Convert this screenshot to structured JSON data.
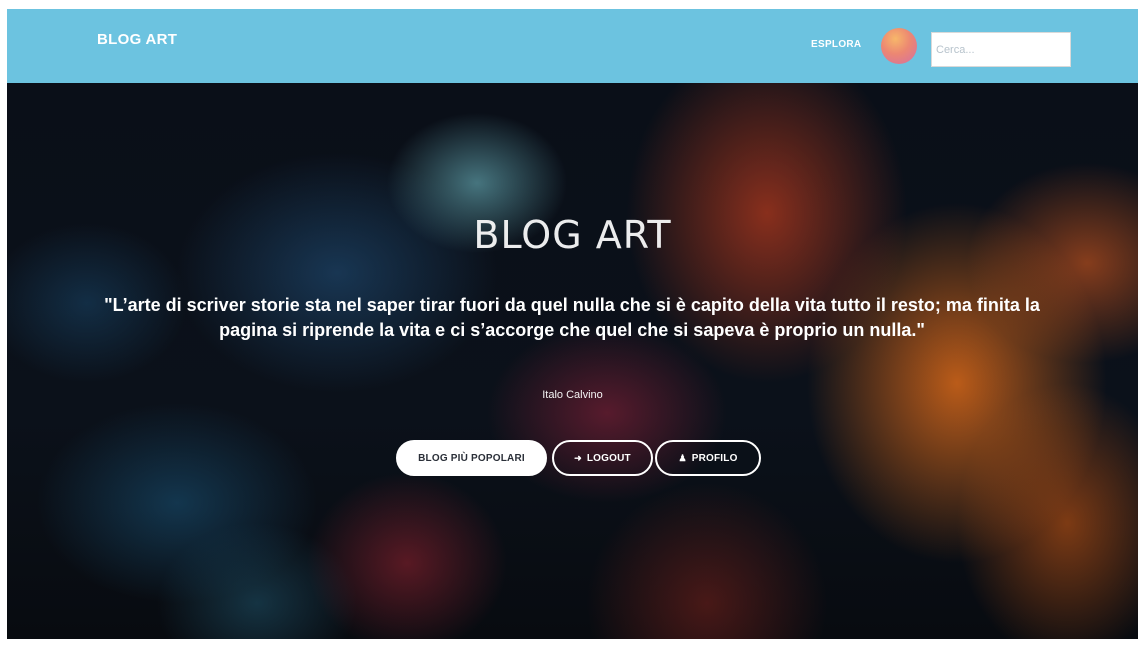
{
  "navbar": {
    "brand": "BLOG ART",
    "explore_label": "ESPLORA",
    "search_placeholder": "Cerca..."
  },
  "hero": {
    "title": "BLOG ART",
    "quote": "\"L’arte di scriver storie sta nel saper tirar fuori da quel nulla che si è capito della vita tutto il resto; ma finita la pagina si riprende la vita e ci s’accorge che quel che si sapeva è proprio un nulla.\"",
    "author": "Italo Calvino"
  },
  "buttons": {
    "popular_label": "BLOG PIÙ POPOLARI",
    "logout_label": "LOGOUT",
    "logout_icon": "➜",
    "profile_label": "PROFILO",
    "profile_icon": "♟"
  },
  "colors": {
    "navbar": "#6cc3e0",
    "hero_dark": "#0b0e14",
    "button_light": "#ffffff",
    "text": "#ffffff"
  }
}
